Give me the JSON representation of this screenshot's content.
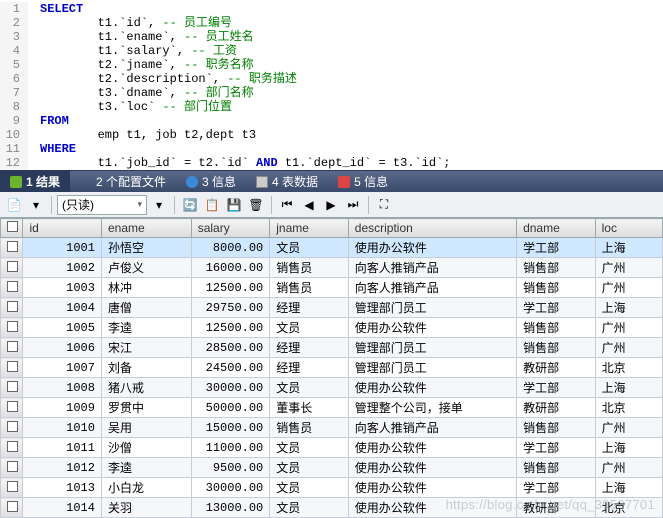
{
  "code": [
    {
      "n": 1,
      "tokens": [
        {
          "t": "SELECT",
          "c": "kw"
        }
      ]
    },
    {
      "n": 2,
      "tokens": [
        {
          "t": "        t1.`id`, ",
          "c": "plain"
        },
        {
          "t": "-- 员工编号",
          "c": "comment"
        }
      ]
    },
    {
      "n": 3,
      "tokens": [
        {
          "t": "        t1.`ename`, ",
          "c": "plain"
        },
        {
          "t": "-- 员工姓名",
          "c": "comment"
        }
      ]
    },
    {
      "n": 4,
      "tokens": [
        {
          "t": "        t1.`salary`, ",
          "c": "plain"
        },
        {
          "t": "-- 工资",
          "c": "comment"
        }
      ]
    },
    {
      "n": 5,
      "tokens": [
        {
          "t": "        t2.`jname`, ",
          "c": "plain"
        },
        {
          "t": "-- 职务名称",
          "c": "comment"
        }
      ]
    },
    {
      "n": 6,
      "tokens": [
        {
          "t": "        t2.`description`, ",
          "c": "plain"
        },
        {
          "t": "-- 职务描述",
          "c": "comment"
        }
      ]
    },
    {
      "n": 7,
      "tokens": [
        {
          "t": "        t3.`dname`, ",
          "c": "plain"
        },
        {
          "t": "-- 部门名称",
          "c": "comment"
        }
      ]
    },
    {
      "n": 8,
      "tokens": [
        {
          "t": "        t3.`loc` ",
          "c": "plain"
        },
        {
          "t": "-- 部门位置",
          "c": "comment"
        }
      ]
    },
    {
      "n": 9,
      "tokens": [
        {
          "t": "FROM",
          "c": "kw"
        }
      ]
    },
    {
      "n": 10,
      "tokens": [
        {
          "t": "        emp t1, job t2,dept t3",
          "c": "plain"
        }
      ]
    },
    {
      "n": 11,
      "tokens": [
        {
          "t": "WHERE",
          "c": "kw"
        }
      ]
    },
    {
      "n": 12,
      "tokens": [
        {
          "t": "        t1.`job_id` = t2.`id` ",
          "c": "plain"
        },
        {
          "t": "AND",
          "c": "kw"
        },
        {
          "t": " t1.`dept_id` = t3.`id`;",
          "c": "plain"
        }
      ]
    }
  ],
  "tabs": [
    {
      "label": "1 结果",
      "active": true,
      "icon": "green"
    },
    {
      "label": "2 个配置文件",
      "icon": "home"
    },
    {
      "label": "3 信息",
      "icon": "globe"
    },
    {
      "label": "4 表数据",
      "icon": "grid"
    },
    {
      "label": "5 信息",
      "icon": "red"
    }
  ],
  "toolbar": {
    "mode_label": "(只读)"
  },
  "columns": [
    "id",
    "ename",
    "salary",
    "jname",
    "description",
    "dname",
    "loc"
  ],
  "rows": [
    {
      "id": "1001",
      "ename": "孙悟空",
      "salary": "8000.00",
      "jname": "文员",
      "description": "使用办公软件",
      "dname": "学工部",
      "loc": "上海",
      "selected": true
    },
    {
      "id": "1002",
      "ename": "卢俊义",
      "salary": "16000.00",
      "jname": "销售员",
      "description": "向客人推销产品",
      "dname": "销售部",
      "loc": "广州"
    },
    {
      "id": "1003",
      "ename": "林冲",
      "salary": "12500.00",
      "jname": "销售员",
      "description": "向客人推销产品",
      "dname": "销售部",
      "loc": "广州"
    },
    {
      "id": "1004",
      "ename": "唐僧",
      "salary": "29750.00",
      "jname": "经理",
      "description": "管理部门员工",
      "dname": "学工部",
      "loc": "上海"
    },
    {
      "id": "1005",
      "ename": "李逵",
      "salary": "12500.00",
      "jname": "文员",
      "description": "使用办公软件",
      "dname": "销售部",
      "loc": "广州"
    },
    {
      "id": "1006",
      "ename": "宋江",
      "salary": "28500.00",
      "jname": "经理",
      "description": "管理部门员工",
      "dname": "销售部",
      "loc": "广州"
    },
    {
      "id": "1007",
      "ename": "刘备",
      "salary": "24500.00",
      "jname": "经理",
      "description": "管理部门员工",
      "dname": "教研部",
      "loc": "北京"
    },
    {
      "id": "1008",
      "ename": "猪八戒",
      "salary": "30000.00",
      "jname": "文员",
      "description": "使用办公软件",
      "dname": "学工部",
      "loc": "上海"
    },
    {
      "id": "1009",
      "ename": "罗贯中",
      "salary": "50000.00",
      "jname": "董事长",
      "description": "管理整个公司，接单",
      "dname": "教研部",
      "loc": "北京"
    },
    {
      "id": "1010",
      "ename": "吴用",
      "salary": "15000.00",
      "jname": "销售员",
      "description": "向客人推销产品",
      "dname": "销售部",
      "loc": "广州"
    },
    {
      "id": "1011",
      "ename": "沙僧",
      "salary": "11000.00",
      "jname": "文员",
      "description": "使用办公软件",
      "dname": "学工部",
      "loc": "上海"
    },
    {
      "id": "1012",
      "ename": "李逵",
      "salary": "9500.00",
      "jname": "文员",
      "description": "使用办公软件",
      "dname": "销售部",
      "loc": "广州"
    },
    {
      "id": "1013",
      "ename": "小白龙",
      "salary": "30000.00",
      "jname": "文员",
      "description": "使用办公软件",
      "dname": "学工部",
      "loc": "上海"
    },
    {
      "id": "1014",
      "ename": "关羽",
      "salary": "13000.00",
      "jname": "文员",
      "description": "使用办公软件",
      "dname": "教研部",
      "loc": "北京"
    }
  ],
  "watermark": "https://blog.csdn.net/qq_39507701"
}
